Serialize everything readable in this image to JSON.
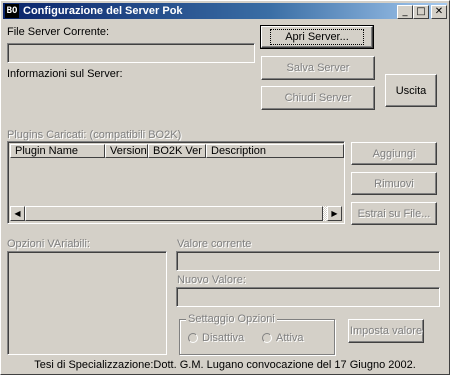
{
  "window": {
    "title": "Configurazione del Server Pok",
    "icon_text": "BO",
    "minimize_glyph": "_",
    "maximize_glyph": "□",
    "close_glyph": "✕"
  },
  "server": {
    "file_label": "File Server Corrente:",
    "file_value": "",
    "info_label": "Informazioni sul Server:",
    "open_button": "Apri Server...",
    "save_button": "Salva Server",
    "close_button": "Chiudi Server",
    "exit_button": "Uscita"
  },
  "plugins": {
    "label": "Plugins Caricati: (compatibili BO2K)",
    "columns": [
      "Plugin Name",
      "Version",
      "BO2K Ver",
      "Description"
    ],
    "rows": [],
    "add_button": "Aggiungi",
    "remove_button": "Rimuovi",
    "extract_button": "Estrai su File...",
    "scroll_left_glyph": "◀",
    "scroll_right_glyph": "▶"
  },
  "options": {
    "variables_label": "Opzioni VAriabili:",
    "current_value_label": "Valore corrente",
    "current_value": "",
    "new_value_label": "Nuovo Valore:",
    "new_value": "",
    "settings_group_label": "Settaggio Opzioni",
    "disable_label": "Disattiva",
    "enable_label": "Attiva",
    "set_value_button": "Imposta valore"
  },
  "footer": {
    "text": "Tesi di Specializzazione:Dott. G.M.  Lugano  convocazione del 17 Giugno 2002."
  }
}
